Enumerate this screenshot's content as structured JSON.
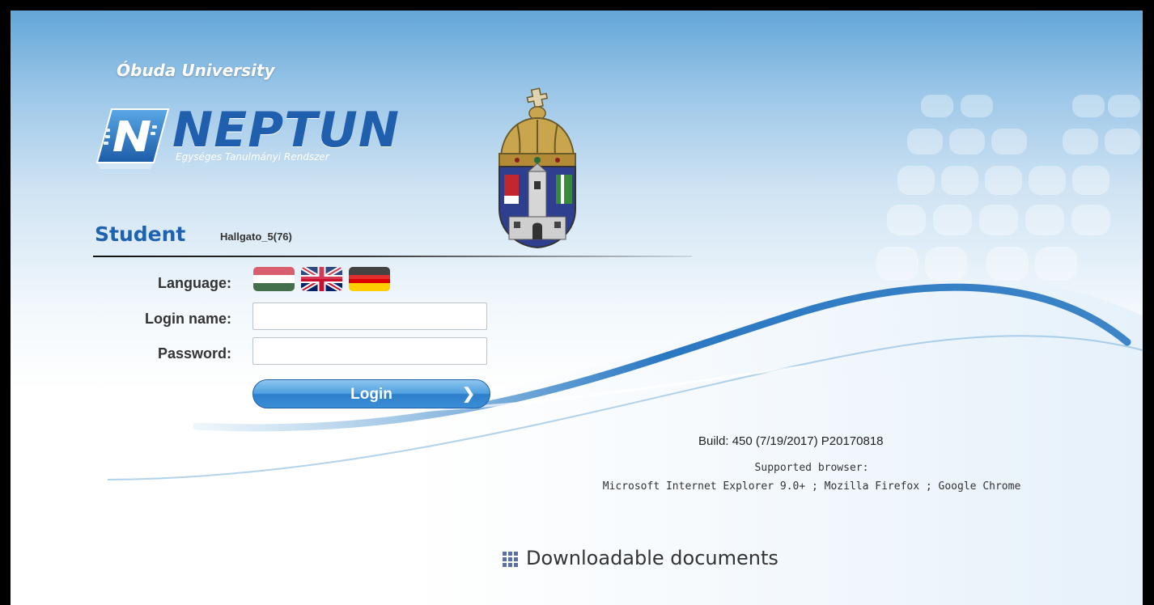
{
  "header": {
    "university_name": "Óbuda University",
    "logo_word": "NEPTUN",
    "logo_subtitle": "Egységes Tanulmányi Rendszer"
  },
  "login_panel": {
    "role_title": "Student",
    "role_subtitle": "Hallgato_5(76)",
    "language_label": "Language:",
    "languages": [
      "hu-flag-icon",
      "uk-flag-icon",
      "de-flag-icon"
    ],
    "login_name_label": "Login name:",
    "login_name_value": "",
    "password_label": "Password:",
    "password_value": "",
    "login_button_label": "Login"
  },
  "footer_info": {
    "build": "Build: 450 (7/19/2017) P20170818",
    "supported_title": "Supported browser:",
    "supported_list": "Microsoft Internet Explorer 9.0+ ; Mozilla Firefox ; Google Chrome"
  },
  "documents": {
    "title": "Downloadable documents"
  },
  "colors": {
    "accent_blue": "#1f63b0",
    "button_blue": "#3a8ed6",
    "header_sky": "#63a6d8"
  }
}
